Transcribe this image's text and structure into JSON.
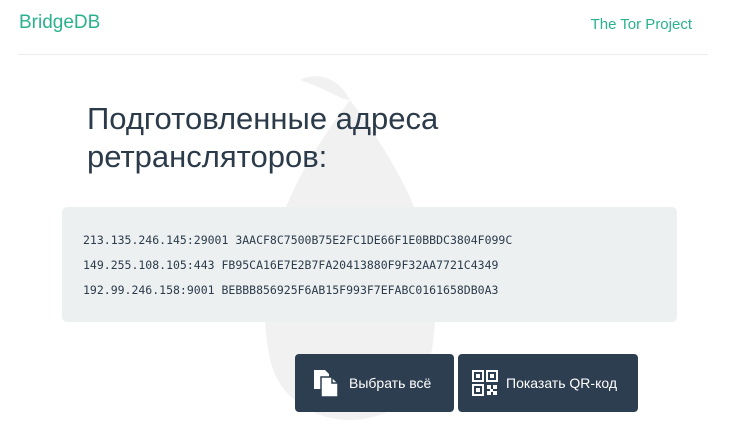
{
  "navbar": {
    "brand": "BridgeDB",
    "tor_link": "The Tor Project"
  },
  "heading": "Подготовленные адреса ретрансляторов:",
  "bridges": [
    "213.135.246.145:29001 3AACF8C7500B75E2FC1DE66F1E0BBDC3804F099C",
    "149.255.108.105:443 FB95CA16E7E2B7FA20413880F9F32AA7721C4349",
    "192.99.246.158:9001 BEBBB856925F6AB15F993F7EFABC0161658DB0A3"
  ],
  "buttons": {
    "select_all": "Выбрать всё",
    "show_qr": "Показать QR-код"
  },
  "colors": {
    "accent": "#2ab28e",
    "button_bg": "#2c3e50",
    "box_bg": "#ecf0f1",
    "text": "#2c3b4a"
  },
  "icons": {
    "select_all": "copy-document-icon",
    "show_qr": "qr-code-icon",
    "watermark": "tor-onion-watermark"
  }
}
